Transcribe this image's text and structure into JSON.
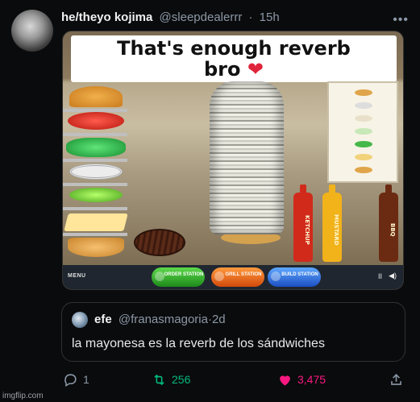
{
  "tweet": {
    "display_name": "he/theyo kojima",
    "handle": "@sleepdealerrr",
    "separator": "·",
    "time": "15h",
    "more_icon": "more-horizontal-icon"
  },
  "media": {
    "caption_line1": "That's enough reverb",
    "caption_line2": "bro",
    "heart": "❤",
    "bottles": {
      "ketchup": "KETCHUP",
      "mustard": "MUSTARD",
      "bbq": "BBQ"
    },
    "game_bar": {
      "menu": "MENU",
      "order_station": "ORDER STATION",
      "grill_station": "GRILL STATION",
      "build_station": "BUILD STATION",
      "pause": "II",
      "sound": "◀)"
    }
  },
  "quote": {
    "display_name": "efe",
    "handle": "@franasmagoria",
    "separator": "·",
    "time": "2d",
    "text": "la mayonesa es la reverb de los sándwiches"
  },
  "actions": {
    "reply_count": "1",
    "retweet_count": "256",
    "like_count": "3,475",
    "colors": {
      "retweet": "#00ba7c",
      "like": "#f91880",
      "muted": "#8b98a5"
    }
  },
  "watermark": "imgflip.com"
}
